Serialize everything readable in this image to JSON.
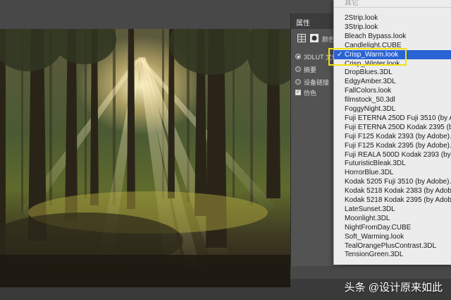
{
  "properties_panel": {
    "title": "属性",
    "color_label": "颜色",
    "options": [
      {
        "label": "3DLUT 文件",
        "type": "radio",
        "checked": true
      },
      {
        "label": "摘要",
        "type": "radio",
        "checked": false
      },
      {
        "label": "设备链接",
        "type": "radio",
        "checked": false
      },
      {
        "label": "仿色",
        "type": "checkbox",
        "checked": true
      }
    ]
  },
  "lut_menu": {
    "header": "其它",
    "selected": "Crisp_Warm.look",
    "items": [
      "2Strip.look",
      "3Strip.look",
      "Bleach Bypass.look",
      "Candlelight.CUBE",
      "Crisp_Warm.look",
      "Crisp_Winter.look",
      "DropBlues.3DL",
      "EdgyAmber.3DL",
      "FallColors.look",
      "filmstock_50.3dl",
      "FoggyNight.3DL",
      "Fuji ETERNA 250D Fuji 3510 (by Adobe",
      "Fuji ETERNA 250D Kodak 2395 (by Ado",
      "Fuji F125 Kodak 2393 (by Adobe).cube",
      "Fuji F125 Kodak 2395 (by Adobe).cube",
      "Fuji REALA 500D Kodak 2393 (by Adobe",
      "FuturisticBleak.3DL",
      "HorrorBlue.3DL",
      "Kodak 5205 Fuji 3510 (by Adobe).cube",
      "Kodak 5218 Kodak 2383 (by Adobe).cub",
      "Kodak 5218 Kodak 2395 (by Adobe).cub",
      "LateSunset.3DL",
      "Moonlight.3DL",
      "NightFromDay.CUBE",
      "Soft_Warming.look",
      "TealOrangePlusContrast.3DL",
      "TensionGreen.3DL"
    ]
  },
  "watermark": "头条 @设计原来如此",
  "colors": {
    "selection": "#2a63d4",
    "highlight_box": "#f1e20f",
    "menu_bg": "#ececec",
    "panel_bg": "#535353"
  }
}
